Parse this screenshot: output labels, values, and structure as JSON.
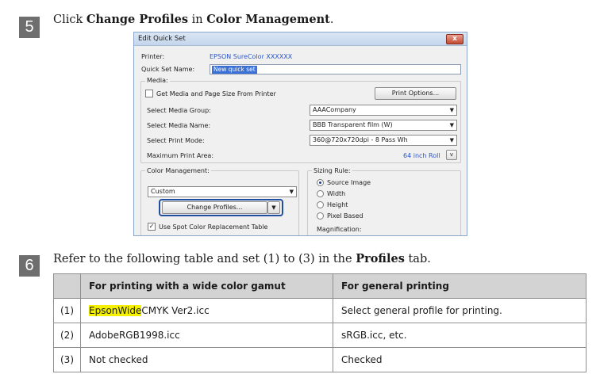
{
  "step5": {
    "number": "5",
    "prefix": "Click ",
    "bold1": "Change Profiles",
    "middle": " in ",
    "bold2": "Color Management",
    "suffix": "."
  },
  "dialog": {
    "title": "Edit Quick Set",
    "close_label": "x",
    "printer_label": "Printer:",
    "printer_value": "EPSON SureColor XXXXXX",
    "quickset_label": "Quick Set Name:",
    "quickset_value": "New quick set",
    "media": {
      "group_label": "Media:",
      "get_media_label": "Get Media and Page Size From Printer",
      "get_media_checked": false,
      "print_options_button": "Print Options...",
      "media_group_label": "Select Media Group:",
      "media_group_value": "AAACompany",
      "media_name_label": "Select Media Name:",
      "media_name_value": "BBB Transparent film (W)",
      "print_mode_label": "Select Print Mode:",
      "print_mode_value": "360@720x720dpi - 8 Pass Wh",
      "max_area_label": "Maximum Print Area:",
      "max_area_value": "64 inch Roll",
      "max_area_button": "v"
    },
    "color_management": {
      "group_label": "Color Management:",
      "mode_value": "Custom",
      "change_profiles_button": "Change Profiles...",
      "spot_color_label": "Use Spot Color Replacement Table",
      "spot_color_checked": true
    },
    "sizing_rule": {
      "group_label": "Sizing Rule:",
      "options": [
        "Source Image",
        "Width",
        "Height",
        "Pixel Based"
      ],
      "selected": "Source Image",
      "magnification_label": "Magnification:"
    }
  },
  "step6": {
    "number": "6",
    "prefix": "Refer to the following table and set (1) to (3) in the ",
    "bold": "Profiles",
    "suffix": " tab."
  },
  "table": {
    "headers": [
      "",
      "For printing with a wide color gamut",
      "For general printing"
    ],
    "rows": [
      {
        "num": "(1)",
        "wide_highlight": "EpsonWide",
        "wide_rest": "CMYK Ver2.icc",
        "general": "Select general profile for printing."
      },
      {
        "num": "(2)",
        "wide_highlight": "",
        "wide_rest": "AdobeRGB1998.icc",
        "general": "sRGB.icc, etc."
      },
      {
        "num": "(3)",
        "wide_highlight": "",
        "wide_rest": "Not checked",
        "general": "Checked"
      }
    ]
  },
  "colors": {
    "step_badge": "#6e6e6e",
    "highlight": "#f5f100",
    "header_fill": "#d3d3d3",
    "focus_outline": "#1f4f9e"
  }
}
